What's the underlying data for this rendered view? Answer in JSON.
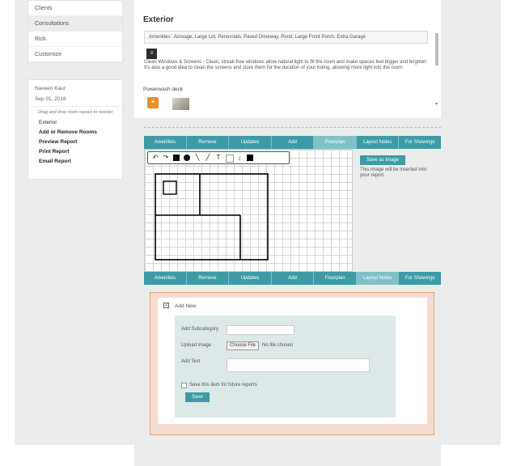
{
  "sidebar": {
    "nav": [
      "Clients",
      "Consultations",
      "Rick",
      "Customize"
    ],
    "active_index": 1,
    "client_name": "Naveen Kaur",
    "date": "Sep 01, 2016",
    "hint": "Drag and drop room names to reorder",
    "room": "Exterior",
    "links": {
      "add_remove": "Add or Remove Rooms",
      "preview": "Preview Report",
      "print": "Print Report",
      "email": "Email Report"
    }
  },
  "section": {
    "title": "Exterior",
    "tags": "Amenities : Acreage, Large Lot, Perennials, Paved Driveway, Pond, Large Front Porch, Extra Garage",
    "description": "Clean Windows & Screens - Clean, streak-free windows allow natural light to fill the room and make spaces feel bigger and brighter!  It's also a good idea to clean the screens and store them for the duration of your listing, allowing more light into the room.",
    "item_title": "Powerwash deck"
  },
  "tabs": [
    "Amenities",
    "Remove",
    "Updates",
    "Add",
    "Floorplan",
    "Layout Notes",
    "For Showings"
  ],
  "tabs_top_selected": 4,
  "tabs_bottom_selected": 5,
  "floorplan": {
    "tools": [
      "↶",
      "↷",
      "T",
      "2"
    ],
    "save_button": "Save as Image",
    "note": "This image will be inserted into your report."
  },
  "notes": {
    "add_new_label": "Add New",
    "subcategory_label": "Add Subcategory",
    "subcategory_value": "",
    "upload_label": "Upload image",
    "file_button": "Choose File",
    "file_status": "No file chosen",
    "text_label": "Add Text",
    "text_value": "",
    "save_future_label": "Save this item for future reports",
    "save_button": "Save"
  },
  "colors": {
    "tab": "#3c9ba5",
    "tab_selected": "#7fc1c7",
    "panel_bg": "#f4ddd0",
    "panel_border": "#e8a373",
    "form_bg": "#dde9e8"
  },
  "icons": {
    "document": "document-icon",
    "powerwash": "spray-icon",
    "checkbox_checked": "checkmark-icon"
  }
}
